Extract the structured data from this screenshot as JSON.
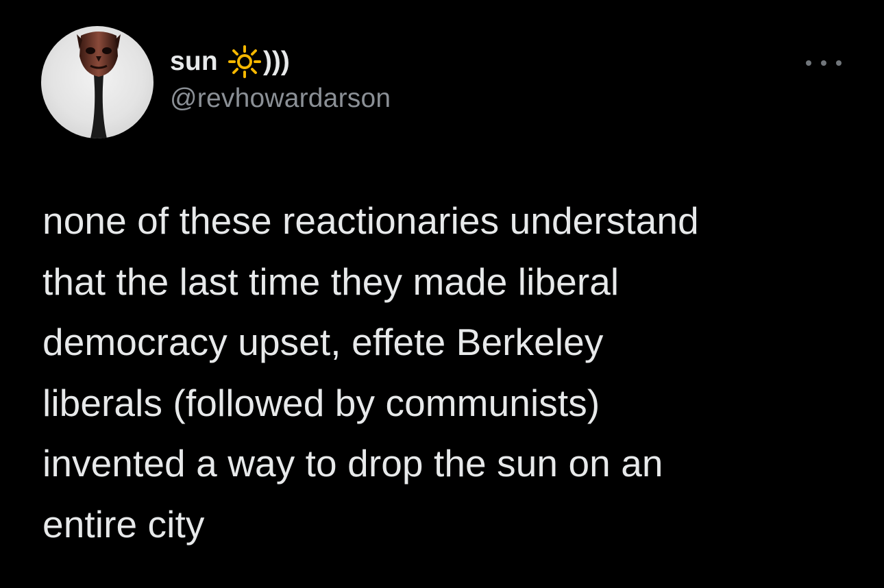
{
  "tweet": {
    "author": {
      "display_name": "sun",
      "name_emoji_icon": "sun-icon",
      "name_suffix": ")))",
      "handle": "@revhowardarson",
      "avatar_icon": "avatar-figure"
    },
    "more_icon": "more-horizontal-icon",
    "text": "none of these reactionaries understand\nthat the last time they made liberal\ndemocracy upset, effete Berkeley\nliberals (followed by communists)\ninvented a way to drop the sun on an\nentire city"
  },
  "colors": {
    "background": "#000000",
    "primary_text": "#e7e9ea",
    "secondary_text": "#8b9096",
    "sun_emoji": "#f5b700"
  }
}
